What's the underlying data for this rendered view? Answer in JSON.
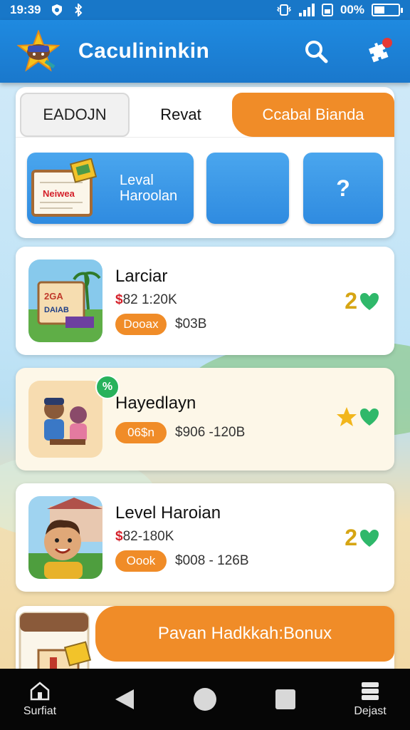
{
  "status_bar": {
    "time": "19:39",
    "battery_percent": "00%"
  },
  "app_bar": {
    "title": "Caculininkin",
    "logo_icon": "star-mascot-icon",
    "search_icon": "search-icon",
    "notification_icon": "puzzle-notification-icon"
  },
  "tabs": [
    {
      "label": "EADOJN",
      "state": "outlined"
    },
    {
      "label": "Revat",
      "state": "plain"
    },
    {
      "label": "Ccabal Bianda",
      "state": "active"
    }
  ],
  "tiles": {
    "tile1_label_line1": "Leval",
    "tile1_label_line2": "Haroolan",
    "tile1_stamp": "Neiwea",
    "tile3_symbol": "?"
  },
  "items": [
    {
      "title": "Larciar",
      "sub_red": "$",
      "sub": "82 1:20K",
      "pill": "Dooax",
      "price": "$03B",
      "count": "2",
      "thumb_text": "2GA\nDAIAB"
    },
    {
      "title": "Hayedlayn",
      "pill": "06$n",
      "price": "$906 -120B",
      "corner_badge": "%"
    },
    {
      "title": "Level Haroian",
      "sub_red": "$",
      "sub": "82-180K",
      "pill": "Oook",
      "price": "$008 - 126B",
      "count": "2"
    }
  ],
  "bonus": {
    "label": "Pavan Hadkkah:Bonux"
  },
  "nav_bar": {
    "left_label": "Surfiat",
    "right_label": "Dejast"
  },
  "colors": {
    "primary_blue": "#1f87d6",
    "accent_orange": "#f08c28",
    "heart_green": "#2fb86a",
    "star_yellow": "#f2b61c",
    "price_red": "#d4202a"
  }
}
